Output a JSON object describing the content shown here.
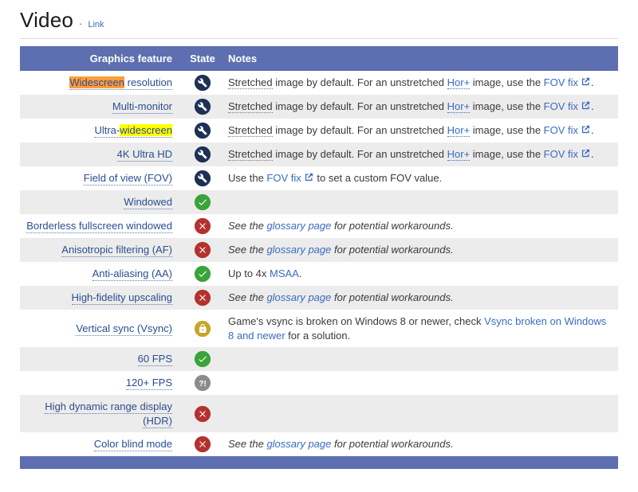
{
  "page": {
    "title": "Video",
    "separator": "·",
    "section_link": "Link"
  },
  "colors": {
    "header_bg": "#5d6fb0",
    "row_alt_bg": "#ececec",
    "feature_link": "#2a4d8f",
    "note_link": "#3a6bc0",
    "highlight_orange": "#ff9d3c",
    "highlight_yellow": "#ffff00",
    "state_true": "#3aa33a",
    "state_false": "#b3322e",
    "state_hackable": "#1d3156",
    "state_always_on": "#c7a424",
    "state_unknown": "#8c8c8c"
  },
  "table": {
    "headers": [
      "Graphics feature",
      "State",
      "Notes"
    ],
    "unknown_glyph": "?!",
    "state_icons": {
      "hackable": "wrench-icon",
      "true": "check-icon",
      "false": "cross-icon",
      "always_on": "lock-icon",
      "unknown": "question-exclamation-icon"
    },
    "rows": [
      {
        "feature": [
          {
            "t": "Widescreen",
            "hl": "orange"
          },
          {
            "t": " resolution"
          }
        ],
        "state": "hackable",
        "italic": false,
        "note": [
          {
            "t": "Stretched",
            "s": "term"
          },
          {
            "t": " image by default. For an unstretched ",
            "s": "plain"
          },
          {
            "t": "Hor+",
            "s": "termlink"
          },
          {
            "t": " image, use the ",
            "s": "plain"
          },
          {
            "t": "FOV fix",
            "s": "link"
          },
          {
            "s": "ext"
          },
          {
            "t": ".",
            "s": "plain"
          }
        ]
      },
      {
        "feature": [
          {
            "t": "Multi-monitor"
          }
        ],
        "state": "hackable",
        "italic": false,
        "note": [
          {
            "t": "Stretched",
            "s": "term"
          },
          {
            "t": " image by default. For an unstretched ",
            "s": "plain"
          },
          {
            "t": "Hor+",
            "s": "termlink"
          },
          {
            "t": " image, use the ",
            "s": "plain"
          },
          {
            "t": "FOV fix",
            "s": "link"
          },
          {
            "s": "ext"
          },
          {
            "t": ".",
            "s": "plain"
          }
        ]
      },
      {
        "feature": [
          {
            "t": "Ultra-"
          },
          {
            "t": "widescreen",
            "hl": "yellow"
          }
        ],
        "state": "hackable",
        "italic": false,
        "note": [
          {
            "t": "Stretched",
            "s": "term"
          },
          {
            "t": " image by default. For an unstretched ",
            "s": "plain"
          },
          {
            "t": "Hor+",
            "s": "termlink"
          },
          {
            "t": " image, use the ",
            "s": "plain"
          },
          {
            "t": "FOV fix",
            "s": "link"
          },
          {
            "s": "ext"
          },
          {
            "t": ".",
            "s": "plain"
          }
        ]
      },
      {
        "feature": [
          {
            "t": "4K Ultra HD"
          }
        ],
        "state": "hackable",
        "italic": false,
        "note": [
          {
            "t": "Stretched",
            "s": "term"
          },
          {
            "t": " image by default. For an unstretched ",
            "s": "plain"
          },
          {
            "t": "Hor+",
            "s": "termlink"
          },
          {
            "t": " image, use the ",
            "s": "plain"
          },
          {
            "t": "FOV fix",
            "s": "link"
          },
          {
            "s": "ext"
          },
          {
            "t": ".",
            "s": "plain"
          }
        ]
      },
      {
        "feature": [
          {
            "t": "Field of view (FOV)"
          }
        ],
        "state": "hackable",
        "italic": false,
        "note": [
          {
            "t": "Use the ",
            "s": "plain"
          },
          {
            "t": "FOV fix",
            "s": "link"
          },
          {
            "s": "ext"
          },
          {
            "t": " to set a custom FOV value.",
            "s": "plain"
          }
        ]
      },
      {
        "feature": [
          {
            "t": "Windowed"
          }
        ],
        "state": "true",
        "italic": false,
        "note": []
      },
      {
        "feature": [
          {
            "t": "Borderless fullscreen windowed"
          }
        ],
        "state": "false",
        "italic": true,
        "note": [
          {
            "t": "See the ",
            "s": "plain"
          },
          {
            "t": "glossary page",
            "s": "link"
          },
          {
            "t": " for potential workarounds.",
            "s": "plain"
          }
        ]
      },
      {
        "feature": [
          {
            "t": "Anisotropic filtering (AF)"
          }
        ],
        "state": "false",
        "italic": true,
        "note": [
          {
            "t": "See the ",
            "s": "plain"
          },
          {
            "t": "glossary page",
            "s": "link"
          },
          {
            "t": " for potential workarounds.",
            "s": "plain"
          }
        ]
      },
      {
        "feature": [
          {
            "t": "Anti-aliasing (AA)"
          }
        ],
        "state": "true",
        "italic": false,
        "note": [
          {
            "t": "Up to 4x ",
            "s": "plain"
          },
          {
            "t": "MSAA",
            "s": "link"
          },
          {
            "t": ".",
            "s": "plain"
          }
        ]
      },
      {
        "feature": [
          {
            "t": "High-fidelity upscaling"
          }
        ],
        "state": "false",
        "italic": true,
        "note": [
          {
            "t": "See the ",
            "s": "plain"
          },
          {
            "t": "glossary page",
            "s": "link"
          },
          {
            "t": " for potential workarounds.",
            "s": "plain"
          }
        ]
      },
      {
        "feature": [
          {
            "t": "Vertical sync (Vsync)"
          }
        ],
        "state": "always_on",
        "italic": false,
        "note": [
          {
            "t": "Game's vsync is broken on Windows 8 or newer, check ",
            "s": "plain"
          },
          {
            "t": "Vsync broken on Windows 8 and newer",
            "s": "link"
          },
          {
            "t": " for a solution.",
            "s": "plain"
          }
        ]
      },
      {
        "feature": [
          {
            "t": "60 FPS"
          }
        ],
        "state": "true",
        "italic": false,
        "note": []
      },
      {
        "feature": [
          {
            "t": "120+ FPS"
          }
        ],
        "state": "unknown",
        "italic": false,
        "note": []
      },
      {
        "feature": [
          {
            "t": "High dynamic range display (HDR)"
          }
        ],
        "state": "false",
        "italic": false,
        "note": []
      },
      {
        "feature": [
          {
            "t": "Color blind mode"
          }
        ],
        "state": "false",
        "italic": true,
        "note": [
          {
            "t": "See the ",
            "s": "plain"
          },
          {
            "t": "glossary page",
            "s": "link"
          },
          {
            "t": " for potential workarounds.",
            "s": "plain"
          }
        ]
      }
    ]
  }
}
